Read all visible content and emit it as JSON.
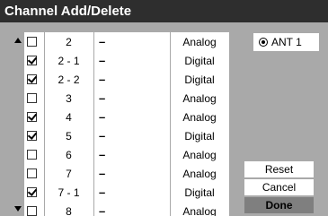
{
  "title": "Channel Add/Delete",
  "antenna": {
    "label": "ANT 1",
    "selected": true
  },
  "channels": [
    {
      "number": "2",
      "name": "–",
      "type": "Analog",
      "checked": false
    },
    {
      "number": "2 - 1",
      "name": "–",
      "type": "Digital",
      "checked": true
    },
    {
      "number": "2 - 2",
      "name": "–",
      "type": "Digital",
      "checked": true
    },
    {
      "number": "3",
      "name": "–",
      "type": "Analog",
      "checked": false
    },
    {
      "number": "4",
      "name": "–",
      "type": "Analog",
      "checked": true
    },
    {
      "number": "5",
      "name": "–",
      "type": "Digital",
      "checked": true
    },
    {
      "number": "6",
      "name": "–",
      "type": "Analog",
      "checked": false
    },
    {
      "number": "7",
      "name": "–",
      "type": "Analog",
      "checked": false
    },
    {
      "number": "7 - 1",
      "name": "–",
      "type": "Digital",
      "checked": true
    },
    {
      "number": "8",
      "name": "–",
      "type": "Analog",
      "checked": false
    }
  ],
  "buttons": {
    "reset": "Reset",
    "cancel": "Cancel",
    "done": "Done"
  }
}
